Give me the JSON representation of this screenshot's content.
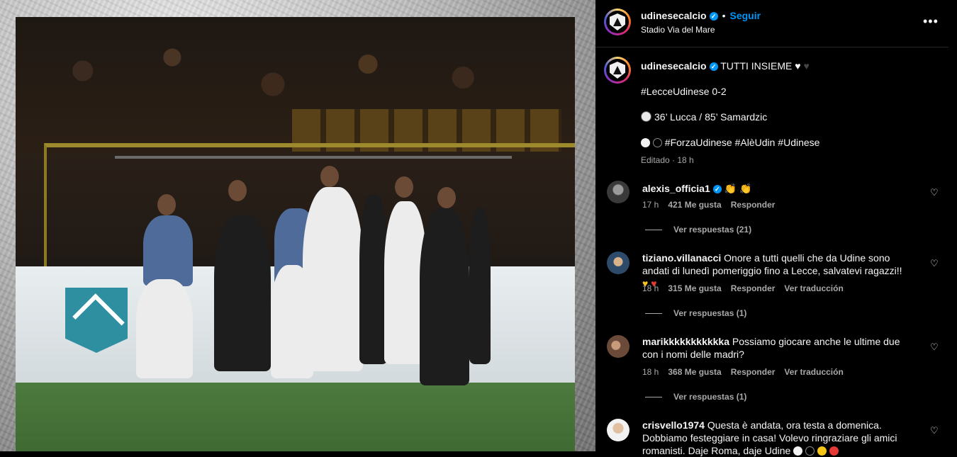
{
  "post": {
    "account": "udinesecalcio",
    "follow_label": "Seguir",
    "separator": "•",
    "location": "Stadio Via del Mare",
    "more_icon": "more-options-icon",
    "caption": {
      "line1": "TUTTI INSIEME",
      "line2": "#LecceUdinese 0-2",
      "line3": "36’ Lucca / 85’ Samardzic",
      "line4": "#ForzaUdinese #AlèUdin #Udinese"
    },
    "edited": "Editado · 18 h",
    "verified_mark": "✓"
  },
  "comments": [
    {
      "user": "alexis_officia1",
      "verified": true,
      "text": "👏 👏",
      "time": "17 h",
      "likes": "421 Me gusta",
      "reply": "Responder",
      "translate": "",
      "replies": "Ver respuestas (21)"
    },
    {
      "user": "tiziano.villanacci",
      "verified": false,
      "text": "Onore a tutti quelli che da Udine sono andati di lunedì pomeriggio fino a Lecce, salvatevi ragazzi!!",
      "time": "18 h",
      "likes": "315 Me gusta",
      "reply": "Responder",
      "translate": "Ver traducción",
      "replies": "Ver respuestas (1)"
    },
    {
      "user": "marikkkkkkkkkkka",
      "verified": false,
      "text": "Possiamo giocare anche le ultime due con i nomi delle madri?",
      "time": "18 h",
      "likes": "368 Me gusta",
      "reply": "Responder",
      "translate": "Ver traducción",
      "replies": "Ver respuestas (1)"
    },
    {
      "user": "crisvello1974",
      "verified": false,
      "text": "Questa è andata, ora testa a domenica. Dobbiamo festeggiare in casa! Volevo ringraziare gli amici romanisti. Daje Roma, daje Udine",
      "time": "",
      "likes": "",
      "reply": "",
      "translate": "",
      "replies": ""
    }
  ],
  "icons": {
    "heart": "heart-outline-icon",
    "verified": "verified-badge-icon"
  },
  "colors": {
    "background": "#000000",
    "link_blue": "#0095f6",
    "muted": "#a8a8a8"
  }
}
